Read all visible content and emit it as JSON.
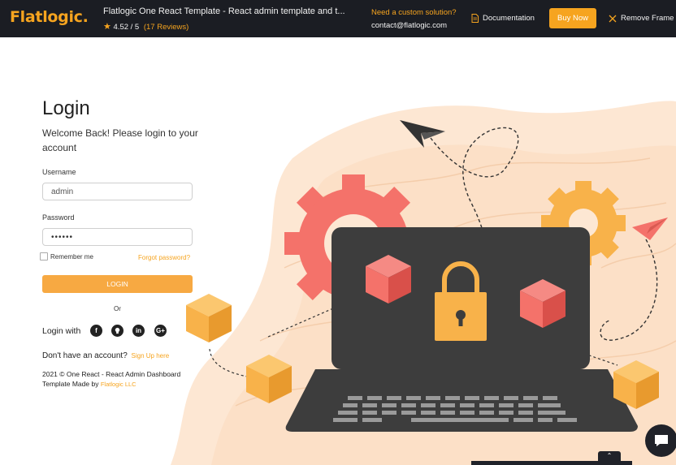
{
  "topbar": {
    "logo": "Flatlogic.",
    "title": "Flatlogic One React Template - React admin template and t...",
    "rating": "4.52 / 5",
    "reviews": "(17 Reviews)",
    "custom_solution": "Need a custom solution?",
    "email": "contact@flatlogic.com",
    "documentation": "Documentation",
    "buy_now": "Buy Now",
    "remove_frame": "Remove Frame"
  },
  "login": {
    "heading": "Login",
    "welcome": "Welcome Back! Please login to your account",
    "username_label": "Username",
    "username_value": "admin",
    "password_label": "Password",
    "password_value": "••••••",
    "remember_me": "Remember me",
    "forgot": "Forgot password?",
    "button": "LOGIN",
    "or": "Or",
    "login_with": "Login with",
    "no_account": "Don't have an account?",
    "signup": "Sign Up here",
    "footer": "2021 © One React - React Admin Dashboard Template Made by",
    "footer_link": "Flatlogic LLC"
  },
  "colors": {
    "accent": "#f6a41f",
    "topbar_bg": "#1b1d23",
    "gear_red": "#f4726a",
    "gear_orange": "#f8b24a",
    "laptop": "#3d3d3d",
    "background_wave": "#fde7d3"
  },
  "icons": {
    "star": "star-icon",
    "doc": "document-icon",
    "close": "close-icon",
    "facebook": "facebook-icon",
    "github": "github-icon",
    "linkedin": "linkedin-icon",
    "google": "google-plus-icon",
    "chat": "chat-icon",
    "chevron": "chevron-up-icon"
  }
}
